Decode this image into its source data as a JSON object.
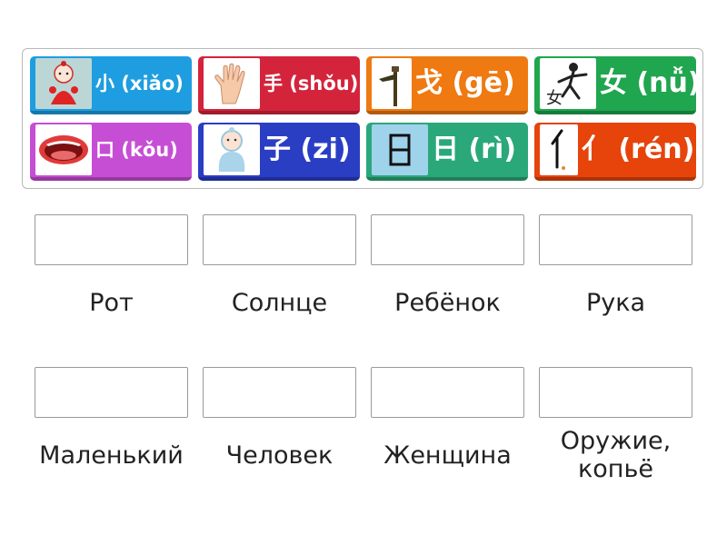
{
  "tiles": [
    {
      "label": "小 (xiǎo)",
      "icon": "baby-doll-icon",
      "color": "#1e9ee0"
    },
    {
      "label": "手 (shǒu)",
      "icon": "hand-icon",
      "color": "#d4243c"
    },
    {
      "label": "戈 (gē)",
      "icon": "halberd-icon",
      "color": "#ef7a12"
    },
    {
      "label": "女 (nǚ)",
      "icon": "woman-character-icon",
      "color": "#1fa64f"
    },
    {
      "label": "口 (kǒu)",
      "icon": "mouth-icon",
      "color": "#c64ed4"
    },
    {
      "label": "子 (zi)",
      "icon": "child-icon",
      "color": "#2a3ec4"
    },
    {
      "label": "日 (rì)",
      "icon": "sun-character-icon",
      "color": "#2aa87a"
    },
    {
      "label": "亻 (rén)",
      "icon": "person-radical-icon",
      "color": "#e6440a"
    }
  ],
  "targets": [
    {
      "caption": "Рот"
    },
    {
      "caption": "Солнце"
    },
    {
      "caption": "Ребёнок"
    },
    {
      "caption": "Рука"
    },
    {
      "caption": "Маленький"
    },
    {
      "caption": "Человек"
    },
    {
      "caption": "Женщина"
    },
    {
      "caption": "Оружие, копьё"
    }
  ]
}
